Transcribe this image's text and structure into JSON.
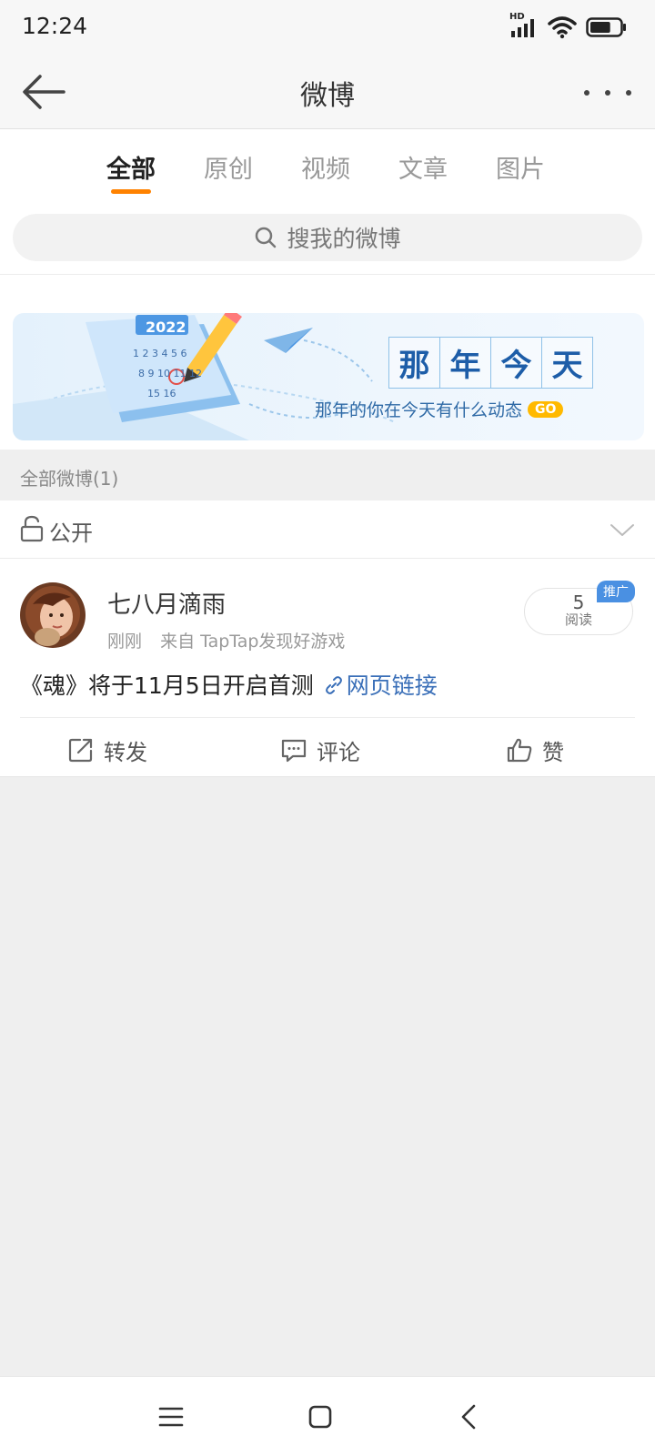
{
  "status": {
    "time": "12:24",
    "network_label": "HD",
    "icons": [
      "signal-icon",
      "wifi-icon",
      "battery-icon"
    ],
    "battery_level": 0.7
  },
  "nav": {
    "title": "微博",
    "back_icon": "back-arrow-icon",
    "more_icon": "more-dots-icon"
  },
  "tabs": [
    {
      "label": "全部",
      "active": true
    },
    {
      "label": "原创",
      "active": false
    },
    {
      "label": "视频",
      "active": false
    },
    {
      "label": "文章",
      "active": false
    },
    {
      "label": "图片",
      "active": false
    }
  ],
  "search": {
    "placeholder": "搜我的微博"
  },
  "banner": {
    "calendar_year": "2022",
    "calendar_days": [
      "1 2 3 4 5 6",
      "8 9 10 11 12",
      "15 16"
    ],
    "title_chars": [
      "那",
      "年",
      "今",
      "天"
    ],
    "subtitle": "那年的你在今天有什么动态",
    "go_label": "GO"
  },
  "section": {
    "label": "全部微博(1)"
  },
  "privacy": {
    "label": "公开"
  },
  "post": {
    "user_name": "七八月滴雨",
    "time": "刚刚",
    "source": "来自 TapTap发现好游戏",
    "read_count": "5",
    "read_label": "阅读",
    "promo_tag": "推广",
    "text": "《魂》将于11月5日开启首测",
    "link_text": "网页链接",
    "actions": {
      "repost": "转发",
      "comment": "评论",
      "like": "赞"
    }
  },
  "colors": {
    "accent": "#ff8200",
    "link": "#3a6fb8",
    "banner_blue": "#1d5da8",
    "promo": "#4a90e2",
    "go": "#ffb900"
  }
}
